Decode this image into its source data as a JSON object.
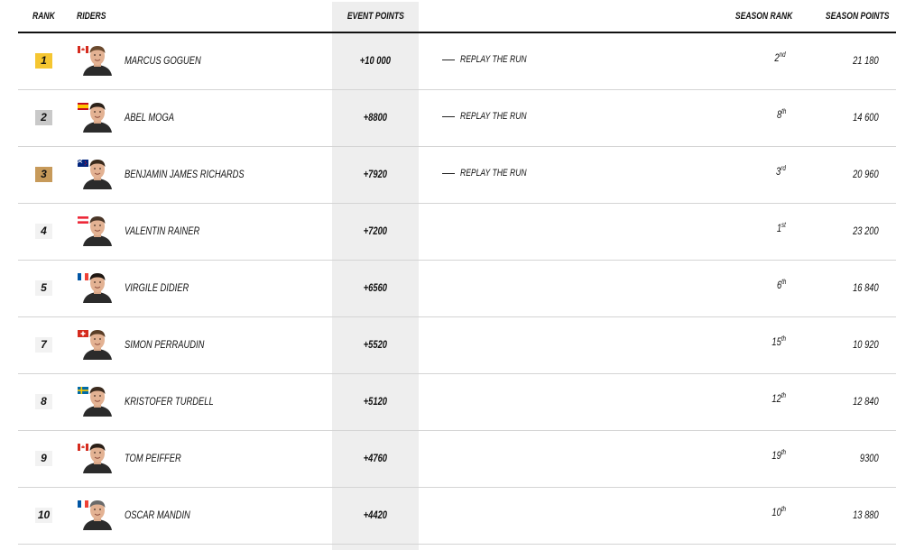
{
  "header": {
    "rank": "RANK",
    "riders": "RIDERS",
    "event_points": "EVENT POINTS",
    "season_rank": "SEASON RANK",
    "season_points": "SEASON POINTS"
  },
  "replay_label": "REPLAY THE RUN",
  "colors": {
    "gold": "#f5c631",
    "silver": "#c9c9c9",
    "bronze": "#c79a5a",
    "event_column_bg": "#eeeeee"
  },
  "rows": [
    {
      "rank": "1",
      "medal": "gold",
      "flag": "canada",
      "name": "MARCUS GOGUEN",
      "event_points": "+10 000",
      "replay": true,
      "season_rank": "2",
      "season_rank_suffix": "nd",
      "season_points": "21 180"
    },
    {
      "rank": "2",
      "medal": "silver",
      "flag": "spain",
      "name": "ABEL MOGA",
      "event_points": "+8800",
      "replay": true,
      "season_rank": "8",
      "season_rank_suffix": "th",
      "season_points": "14 600"
    },
    {
      "rank": "3",
      "medal": "bronze",
      "flag": "new-zealand",
      "name": "BENJAMIN JAMES RICHARDS",
      "event_points": "+7920",
      "replay": true,
      "season_rank": "3",
      "season_rank_suffix": "rd",
      "season_points": "20 960"
    },
    {
      "rank": "4",
      "medal": "none",
      "flag": "austria",
      "name": "VALENTIN RAINER",
      "event_points": "+7200",
      "replay": false,
      "season_rank": "1",
      "season_rank_suffix": "st",
      "season_points": "23 200"
    },
    {
      "rank": "5",
      "medal": "none",
      "flag": "france",
      "name": "VIRGILE DIDIER",
      "event_points": "+6560",
      "replay": false,
      "season_rank": "6",
      "season_rank_suffix": "th",
      "season_points": "16 840"
    },
    {
      "rank": "7",
      "medal": "none",
      "flag": "switzerland",
      "name": "SIMON PERRAUDIN",
      "event_points": "+5520",
      "replay": false,
      "season_rank": "15",
      "season_rank_suffix": "th",
      "season_points": "10 920"
    },
    {
      "rank": "8",
      "medal": "none",
      "flag": "sweden",
      "name": "KRISTOFER TURDELL",
      "event_points": "+5120",
      "replay": false,
      "season_rank": "12",
      "season_rank_suffix": "th",
      "season_points": "12 840"
    },
    {
      "rank": "9",
      "medal": "none",
      "flag": "canada",
      "name": "TOM PEIFFER",
      "event_points": "+4760",
      "replay": false,
      "season_rank": "19",
      "season_rank_suffix": "th",
      "season_points": "9300"
    },
    {
      "rank": "10",
      "medal": "none",
      "flag": "france",
      "name": "OSCAR MANDIN",
      "event_points": "+4420",
      "replay": false,
      "season_rank": "10",
      "season_rank_suffix": "th",
      "season_points": "13 880"
    }
  ]
}
